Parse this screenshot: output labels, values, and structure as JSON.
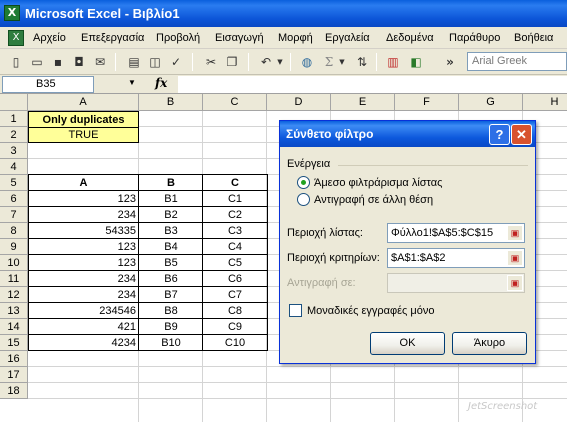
{
  "window": {
    "title": "Microsoft Excel - Βιβλίο1",
    "app_icon": "excel-icon"
  },
  "menu": [
    "Αρχείο",
    "Επεξεργασία",
    "Προβολή",
    "Εισαγωγή",
    "Μορφή",
    "Εργαλεία",
    "Δεδομένα",
    "Παράθυρο",
    "Βοήθεια"
  ],
  "toolbar": {
    "font_name": "Arial Greek",
    "autosum_glyph": "Σ",
    "chevron_glyph": "»"
  },
  "formula_bar": {
    "name_box": "B35",
    "fx_label": "fx",
    "formula": ""
  },
  "columns": [
    "A",
    "B",
    "C",
    "D",
    "E",
    "F",
    "G",
    "H"
  ],
  "rows": [
    "1",
    "2",
    "3",
    "4",
    "5",
    "6",
    "7",
    "8",
    "9",
    "10",
    "11",
    "12",
    "13",
    "14",
    "15",
    "16",
    "17",
    "18"
  ],
  "criteria": {
    "header": "Only duplicates",
    "value": "TRUE"
  },
  "table": {
    "headers": [
      "A",
      "B",
      "C"
    ],
    "rows": [
      [
        "123",
        "B1",
        "C1"
      ],
      [
        "234",
        "B2",
        "C2"
      ],
      [
        "54335",
        "B3",
        "C3"
      ],
      [
        "123",
        "B4",
        "C4"
      ],
      [
        "123",
        "B5",
        "C5"
      ],
      [
        "234",
        "B6",
        "C6"
      ],
      [
        "234",
        "B7",
        "C7"
      ],
      [
        "234546",
        "B8",
        "C8"
      ],
      [
        "421",
        "B9",
        "C9"
      ],
      [
        "4234",
        "B10",
        "C10"
      ]
    ]
  },
  "dialog": {
    "title": "Σύνθετο φίλτρο",
    "help": "?",
    "close": "✕",
    "group_label": "Ενέργεια",
    "radio_inplace": "Άμεσο φιλτράρισμα λίστας",
    "radio_copy": "Αντιγραφή σε άλλη θέση",
    "selected_action": "inplace",
    "list_range_label": "Περιοχή λίστας:",
    "list_range_value": "Φύλλο1!$A$5:$C$15",
    "criteria_range_label": "Περιοχή κριτηρίων:",
    "criteria_range_value": "$A$1:$A$2",
    "copy_to_label": "Αντιγραφή σε:",
    "copy_to_value": "",
    "unique_label": "Μοναδικές εγγραφές μόνο",
    "unique_checked": false,
    "ok_label": "OK",
    "cancel_label": "Άκυρο"
  },
  "watermark": "JetScreenshot"
}
